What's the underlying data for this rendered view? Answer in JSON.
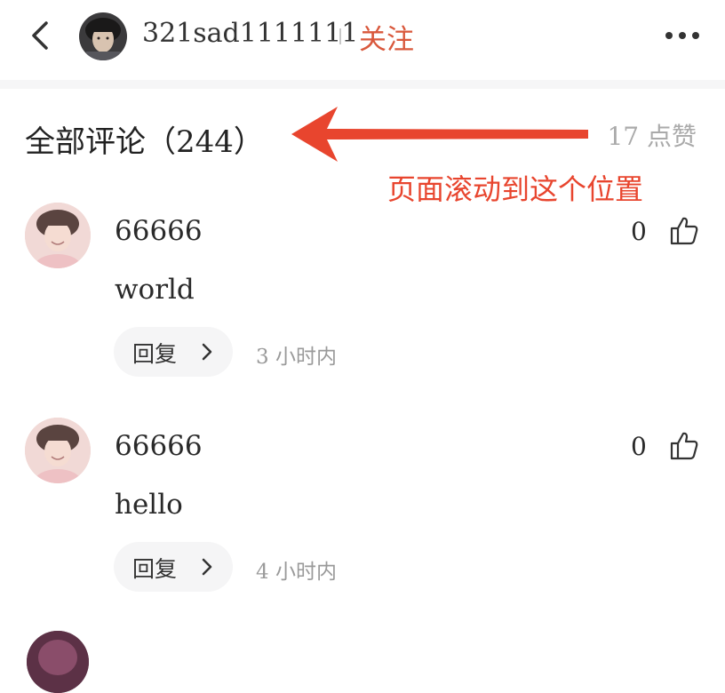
{
  "header": {
    "author_name": "321sad1111111",
    "follow_label": "关注",
    "follow_color": "#d9583c"
  },
  "section": {
    "title": "全部评论（244）",
    "likes_total": "17 点赞"
  },
  "annotation": {
    "text": "页面滚动到这个位置",
    "color": "#e8452e"
  },
  "comments": [
    {
      "user": "66666",
      "likes": "0",
      "text": "world",
      "reply_label": "回复",
      "time": "3 小时内"
    },
    {
      "user": "66666",
      "likes": "0",
      "text": "hello",
      "reply_label": "回复",
      "time": "4 小时内"
    }
  ],
  "icons": {
    "back": "chevron-left-icon",
    "more": "more-dots-icon",
    "like": "thumb-up-icon",
    "reply_arrow": "chevron-right-icon"
  }
}
